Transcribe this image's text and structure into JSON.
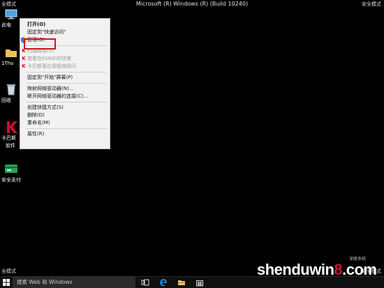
{
  "corner_top_left": "全模式",
  "corner_top_right": "安全模式",
  "corner_bottom_left": "全模式",
  "corner_bottom_right": "安全模式",
  "os_title": "Microsoft (R) Windows (R) (Build 10240)",
  "desktop_icons": [
    {
      "label": "此电",
      "icon": "computer-icon"
    },
    {
      "label": "1Tho",
      "icon": "folder-icon"
    },
    {
      "label": "回收",
      "icon": "recycle-bin-icon"
    },
    {
      "label": "卡巴斯",
      "label2": "软件",
      "icon": "kaspersky-icon"
    },
    {
      "label": "安全支付",
      "icon": "safe-pay-icon"
    }
  ],
  "context_menu": {
    "open": "打开(O)",
    "pin_quick_access": "固定到\"快速访问\"",
    "manage": "管理(G)",
    "scan": "扫描病毒(V)",
    "ksn": "查看在KSN中的信誉",
    "kaspersky_apps": "卡巴斯基应用程序顾问",
    "pin_start": "固定到\"开始\"屏幕(P)",
    "map_drive": "映射网络驱动器(N)...",
    "disconnect_drive": "断开网络驱动器的连接(C)...",
    "create_shortcut": "创建快捷方式(S)",
    "delete": "删除(D)",
    "rename": "重命名(M)",
    "properties": "属性(R)"
  },
  "taskbar": {
    "search_placeholder": "搜索 Web 和 Windows"
  },
  "watermark": {
    "text_main": "shenduwin",
    "text_8": "8",
    "text_end": ".com",
    "sub": "深度系统"
  },
  "colors": {
    "highlight_border": "#d4141b",
    "kaspersky_red": "#d0102a",
    "accent_blue": "#1e7fd8"
  }
}
